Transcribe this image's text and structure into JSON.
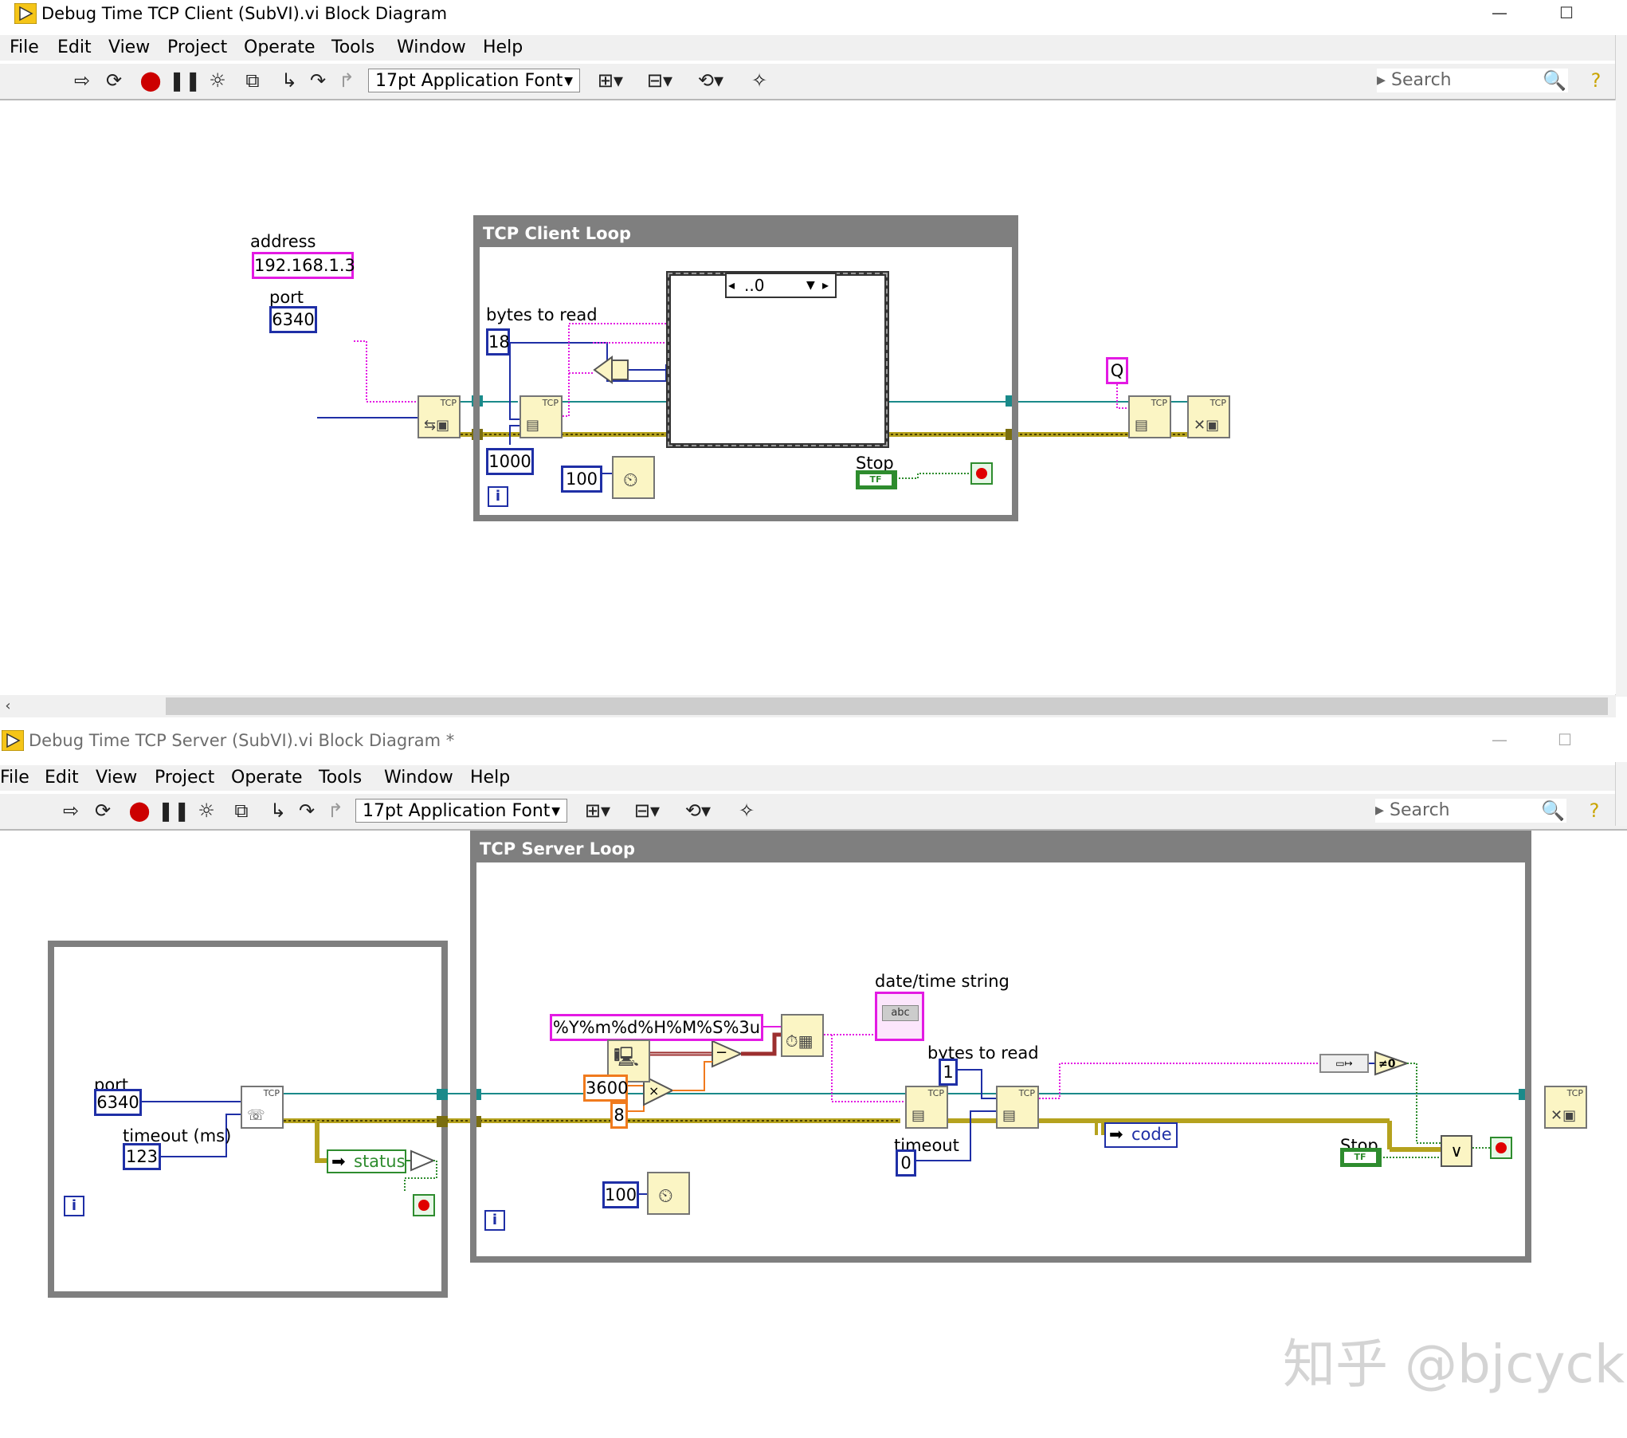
{
  "client": {
    "title": "Debug Time TCP Client (SubVI).vi Block Diagram",
    "menu": [
      "File",
      "Edit",
      "View",
      "Project",
      "Operate",
      "Tools",
      "Window",
      "Help"
    ],
    "font_select": "17pt Application Font",
    "search_placeholder": "Search",
    "loop_title": "TCP Client Loop",
    "address_label": "address",
    "address_value": "192.168.1.3",
    "port_label": "port",
    "port_value": "6340",
    "bytes_label": "bytes to read",
    "bytes_value": "18",
    "timeout_value": "1000",
    "wait_value": "100",
    "case_selector": "..0",
    "stop_label": "Stop",
    "q_const": "Q",
    "tf_text": "TF",
    "iter_text": "i",
    "tcp_tag": "TCP"
  },
  "server": {
    "title": "Debug Time TCP Server (SubVI).vi Block Diagram *",
    "menu": [
      "File",
      "Edit",
      "View",
      "Project",
      "Operate",
      "Tools",
      "Window",
      "Help"
    ],
    "font_select": "17pt Application Font",
    "search_placeholder": "Search",
    "loop_title": "TCP Server Loop",
    "port_label": "port",
    "port_value": "6340",
    "timeout_label": "timeout (ms)",
    "timeout_value": "123",
    "status_label": "status",
    "format_string": "%Y%m%d%H%M%S%3u",
    "datetime_label": "date/time string",
    "bytes_label": "bytes to read",
    "bytes_value": "1",
    "timeout2_label": "timeout",
    "timeout2_value": "0",
    "c3600": "3600",
    "c8": "8",
    "code_label": "code",
    "stop_label": "Stop",
    "wait_value": "100",
    "tf_text": "TF",
    "iter_text": "i",
    "tcp_tag": "TCP",
    "abc_text": "abc",
    "neq_zero": "≠0",
    "minus": "−",
    "times": "×",
    "or_text": "∨"
  },
  "watermark": "知乎 @bjcyck",
  "colors": {
    "numeric": "#1f2fa6",
    "string": "#e31ae3",
    "refnum": "#1a8a8a",
    "error_cluster": "#b5a21e",
    "boolean": "#2e8c2e",
    "dbl": "#f07a1d",
    "timestamp": "#9c2f2f",
    "loop": "#7f7f7f",
    "node_fill": "#fbf5c4"
  },
  "icons": [
    "run-arrow-icon",
    "run-continuous-icon",
    "abort-icon",
    "pause-icon",
    "highlight-bulb-icon",
    "retain-wire-icon",
    "step-into-icon",
    "step-over-icon",
    "step-out-icon",
    "align-icon",
    "distribute-icon",
    "reorder-icon",
    "cleanup-icon",
    "search-icon",
    "help-icon"
  ]
}
